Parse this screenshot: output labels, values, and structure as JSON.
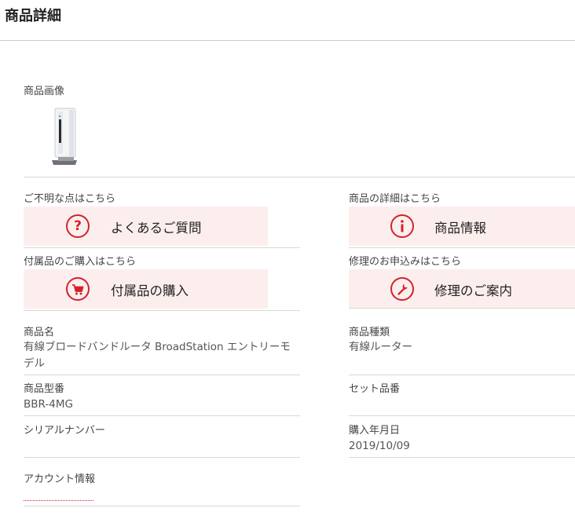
{
  "page": {
    "title": "商品詳細"
  },
  "product_image": {
    "label": "商品画像"
  },
  "help": {
    "faq": {
      "caption": "ご不明な点はこちら",
      "button_label": "よくあるご質問",
      "icon": "question-circle-icon"
    },
    "info": {
      "caption": "商品の詳細はこちら",
      "button_label": "商品情報",
      "icon": "info-circle-icon"
    },
    "accessory": {
      "caption": "付属品のご購入はこちら",
      "button_label": "付属品の購入",
      "icon": "cart-icon"
    },
    "repair": {
      "caption": "修理のお申込みはこちら",
      "button_label": "修理のご案内",
      "icon": "wrench-icon"
    }
  },
  "details": {
    "product_name": {
      "label": "商品名",
      "value": "有線ブロードバンドルータ BroadStation エントリーモデル"
    },
    "product_type": {
      "label": "商品種類",
      "value": "有線ルーター"
    },
    "model_number": {
      "label": "商品型番",
      "value": "BBR-4MG"
    },
    "set_number": {
      "label": "セット品番",
      "value": ""
    },
    "serial_number": {
      "label": "シリアルナンバー",
      "value": ""
    },
    "purchase_date": {
      "label": "購入年月日",
      "value": "2019/10/09"
    },
    "account": {
      "label": "アカウント情報",
      "value": ""
    }
  },
  "colors": {
    "accent": "#d2232a",
    "button_bg": "#fdeeee",
    "divider": "#d9d9d9"
  }
}
